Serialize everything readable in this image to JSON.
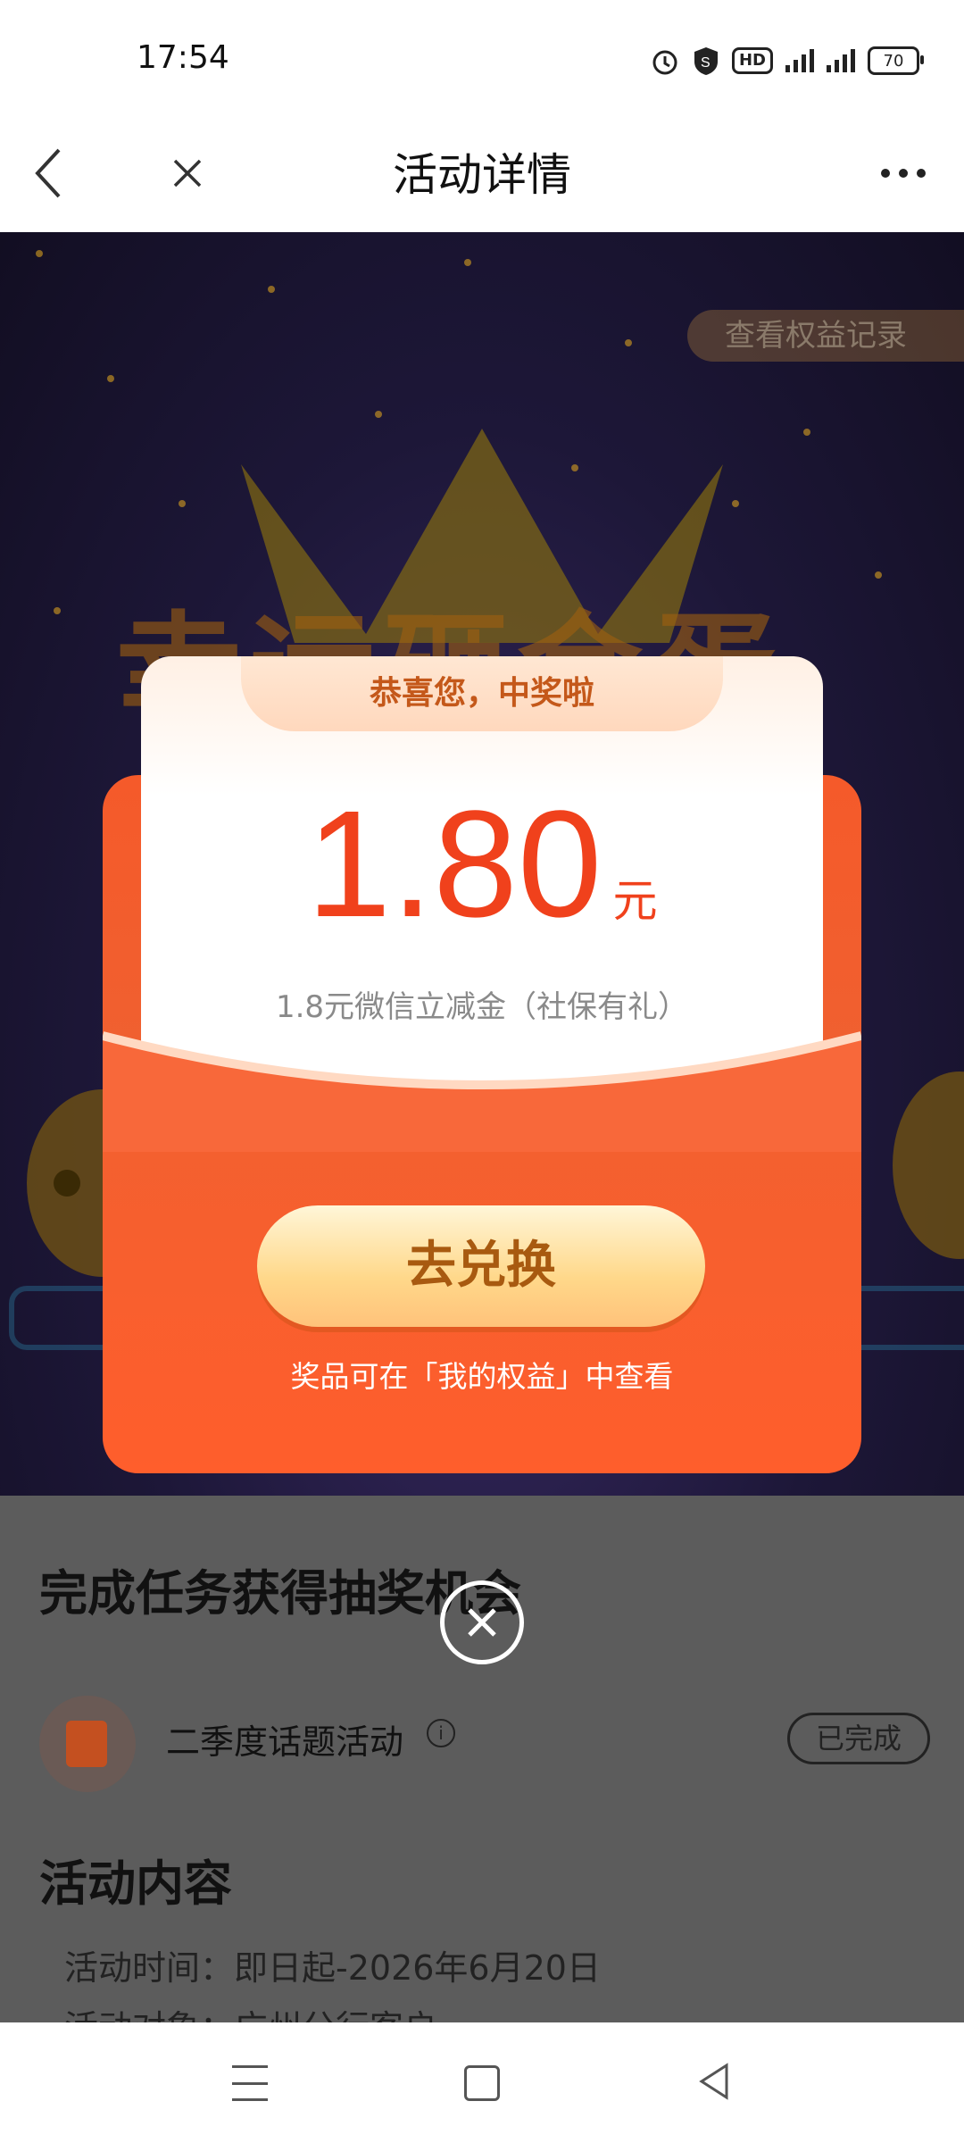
{
  "status_bar": {
    "time": "17:54",
    "hd": "HD",
    "battery": "70"
  },
  "header": {
    "title": "活动详情"
  },
  "banner": {
    "records_button": "查看权益记录",
    "title_text": "幸运砸金蛋"
  },
  "modal": {
    "congrats": "恭喜您，中奖啦",
    "amount": "1.80",
    "unit": "元",
    "description": "1.8元微信立减金（社保有礼）",
    "redeem_button": "去兑换",
    "hint": "奖品可在「我的权益」中查看"
  },
  "tasks": {
    "section_title": "完成任务获得抽奖机会",
    "items": [
      {
        "label": "二季度话题活动",
        "status": "已完成"
      }
    ]
  },
  "activity": {
    "section_title": "活动内容",
    "time_line": "活动时间：即日起-2026年6月20日",
    "target_line": "活动对象：广州分行客户"
  },
  "colors": {
    "accent": "#f0411c",
    "modal_red": "#f55a2a",
    "button_gold": "#ffd88a"
  }
}
